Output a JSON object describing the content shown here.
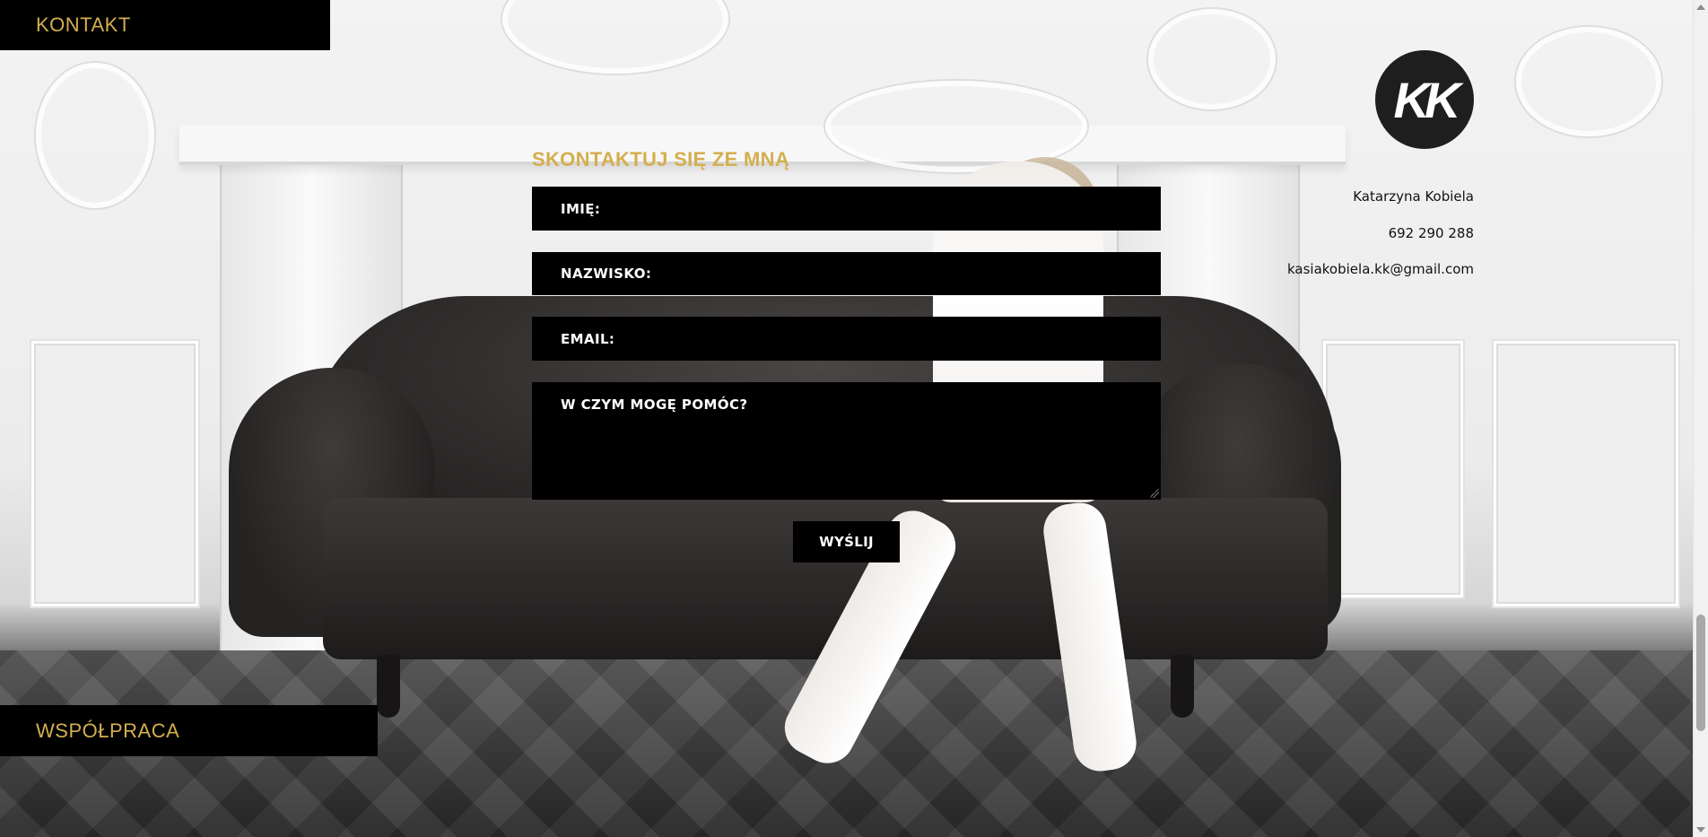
{
  "nav": {
    "kontakt_label": "KONTAKT",
    "wspolpraca_label": "WSPÓŁPRACA"
  },
  "form": {
    "title": "SKONTAKTUJ SIĘ ZE MNĄ",
    "first_name_placeholder": "IMIĘ:",
    "last_name_placeholder": "NAZWISKO:",
    "email_placeholder": "EMAIL:",
    "message_placeholder": "W CZYM MOGĘ POMÓC?",
    "submit_label": "WYŚLIJ"
  },
  "contact": {
    "logo_text": "KK",
    "name": "Katarzyna Kobiela",
    "phone": "692 290 288",
    "email": "kasiakobiela.kk@gmail.com"
  },
  "theme": {
    "accent": "#d4af4f",
    "field_background": "#000000",
    "field_text": "#ffffff"
  },
  "icons": {
    "logo": "kk-monogram-logo"
  }
}
